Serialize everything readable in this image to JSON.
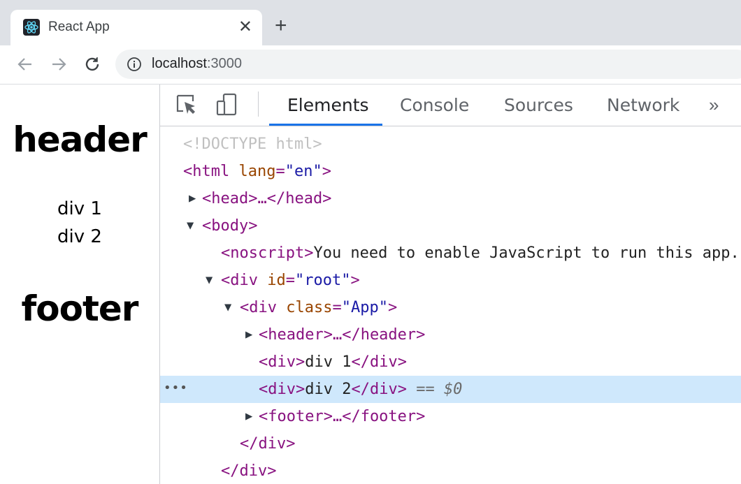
{
  "browser": {
    "tab_title": "React App",
    "tab_close": "✕",
    "new_tab": "+",
    "url_host": "localhost",
    "url_port": ":3000",
    "favicon": "react-logo-icon"
  },
  "page": {
    "header": "header",
    "div1": "div 1",
    "div2": "div 2",
    "footer": "footer"
  },
  "devtools": {
    "tabs": [
      "Elements",
      "Console",
      "Sources",
      "Network"
    ],
    "active_tab": "Elements",
    "more": "»",
    "dom": {
      "doctype": "<!DOCTYPE html>",
      "html_open": "<html",
      "html_attr_name": "lang",
      "html_attr_value": "\"en\"",
      "head": "<head>…</head>",
      "body_open": "<body>",
      "noscript_open": "<noscript>",
      "noscript_text": "You need to enable JavaScript to run this app.",
      "root_open": "<div",
      "root_attr_name": "id",
      "root_attr_value": "\"root\"",
      "app_open": "<div",
      "app_attr_name": "class",
      "app_attr_value": "\"App\"",
      "header_collapsed": "<header>…</header>",
      "div_open": "<div>",
      "div1_text": "div 1",
      "div2_text": "div 2",
      "div_close": "</div>",
      "selected_marker": "== $0",
      "footer_collapsed": "<footer>…</footer>",
      "close_div_app": "</div>",
      "close_div_root": "</div>"
    }
  }
}
